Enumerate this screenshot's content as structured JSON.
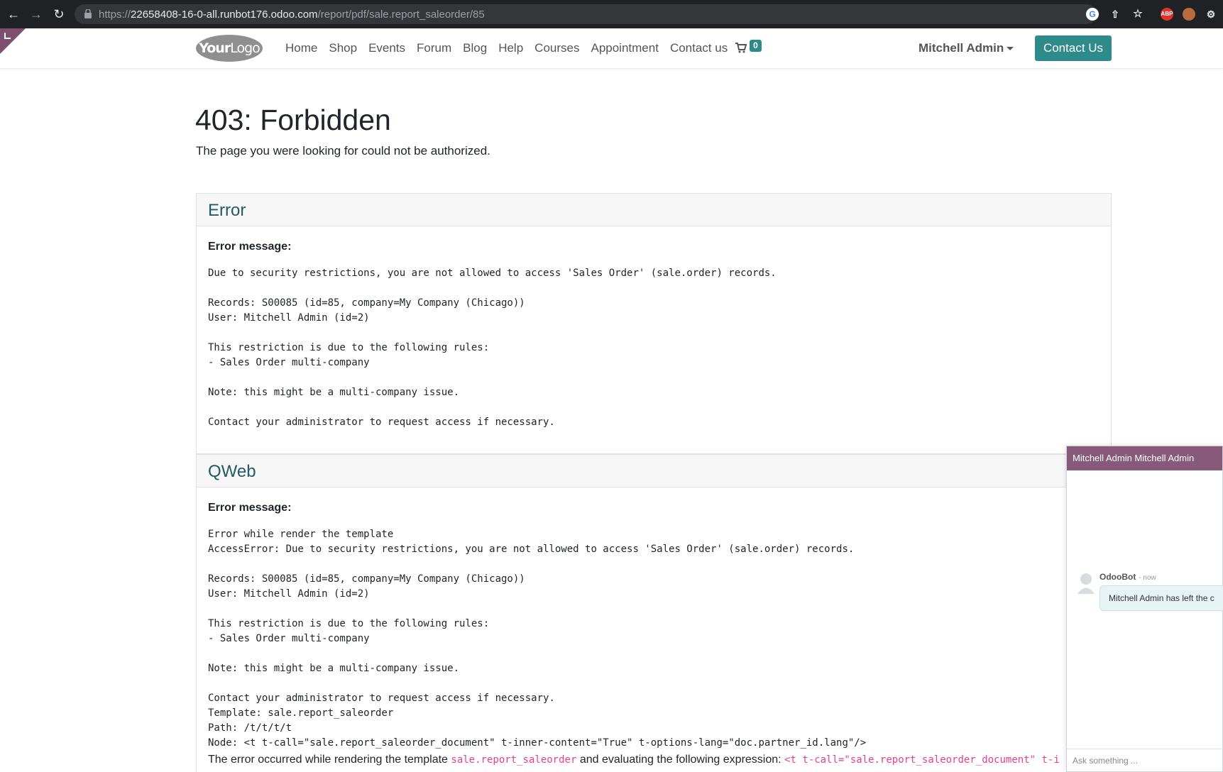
{
  "browser": {
    "url_scheme": "https://",
    "url_host": "22658408-16-0-all.runbot176.odoo.com",
    "url_path": "/report/pdf/sale.report_saleorder/85"
  },
  "header": {
    "logo_text_bold": "Your",
    "logo_text": "Logo",
    "menu": [
      "Home",
      "Shop",
      "Events",
      "Forum",
      "Blog",
      "Help",
      "Courses",
      "Appointment",
      "Contact us"
    ],
    "cart_count": "0",
    "user_name": "Mitchell Admin",
    "contact_button": "Contact Us"
  },
  "page": {
    "title": "403: Forbidden",
    "subtitle": "The page you were looking for could not be authorized."
  },
  "error_card": {
    "heading": "Error",
    "label": "Error message:",
    "message": "Due to security restrictions, you are not allowed to access 'Sales Order' (sale.order) records.\n\nRecords: S00085 (id=85, company=My Company (Chicago))\nUser: Mitchell Admin (id=2)\n\nThis restriction is due to the following rules:\n- Sales Order multi-company\n\nNote: this might be a multi-company issue.\n\nContact your administrator to request access if necessary."
  },
  "qweb_card": {
    "heading": "QWeb",
    "label": "Error message:",
    "message": "Error while render the template\nAccessError: Due to security restrictions, you are not allowed to access 'Sales Order' (sale.order) records.\n\nRecords: S00085 (id=85, company=My Company (Chicago))\nUser: Mitchell Admin (id=2)\n\nThis restriction is due to the following rules:\n- Sales Order multi-company\n\nNote: this might be a multi-company issue.\n\nContact your administrator to request access if necessary.\nTemplate: sale.report_saleorder\nPath: /t/t/t/t\nNode: <t t-call=\"sale.report_saleorder_document\" t-inner-content=\"True\" t-options-lang=\"doc.partner_id.lang\"/>",
    "footer_text_1": "The error occurred while rendering the template ",
    "footer_code_1": "sale.report_saleorder",
    "footer_text_2": " and evaluating the following expression: ",
    "footer_code_2": "<t t-call=\"sale.report_saleorder_document\" t-i"
  },
  "chat": {
    "title": "Mitchell Admin Mitchell Admin",
    "author": "OdooBot",
    "time": "- now",
    "message": "Mitchell Admin has left the c",
    "input_placeholder": "Ask something ..."
  },
  "colors": {
    "accent": "#2f8b8b",
    "chat_header": "#875a7b",
    "card_heading": "#245b62"
  }
}
